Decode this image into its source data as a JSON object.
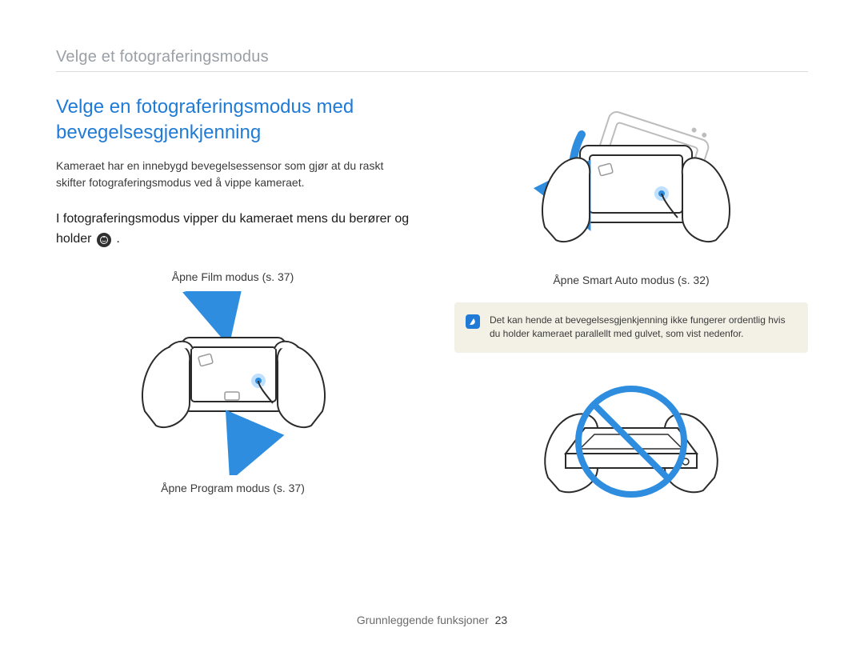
{
  "header": {
    "breadcrumb": "Velge et fotograferingsmodus"
  },
  "section": {
    "title": "Velge en fotograferingsmodus med bevegelsesgjenkjenning",
    "intro": "Kameraet har en innebygd bevegelsessensor som gjør at du raskt skifter fotograferingsmodus ved å vippe kameraet.",
    "instruction_prefix": "I fotograferingsmodus vipper du kameraet mens du berører og holder ",
    "instruction_suffix": ".",
    "mode_icon_name": "mode-dial-icon"
  },
  "left_column": {
    "top_caption": "Åpne Film modus (s. 37)",
    "bottom_caption": "Åpne Program modus (s. 37)"
  },
  "right_column": {
    "top_caption": "Åpne Smart Auto modus (s. 32)",
    "note": "Det kan hende at bevegelsesgjenkjenning ikke fungerer ordentlig hvis du holder kameraet parallellt med gulvet, som vist nedenfor."
  },
  "footer": {
    "section_label": "Grunnleggende funksjoner",
    "page_number": "23"
  }
}
